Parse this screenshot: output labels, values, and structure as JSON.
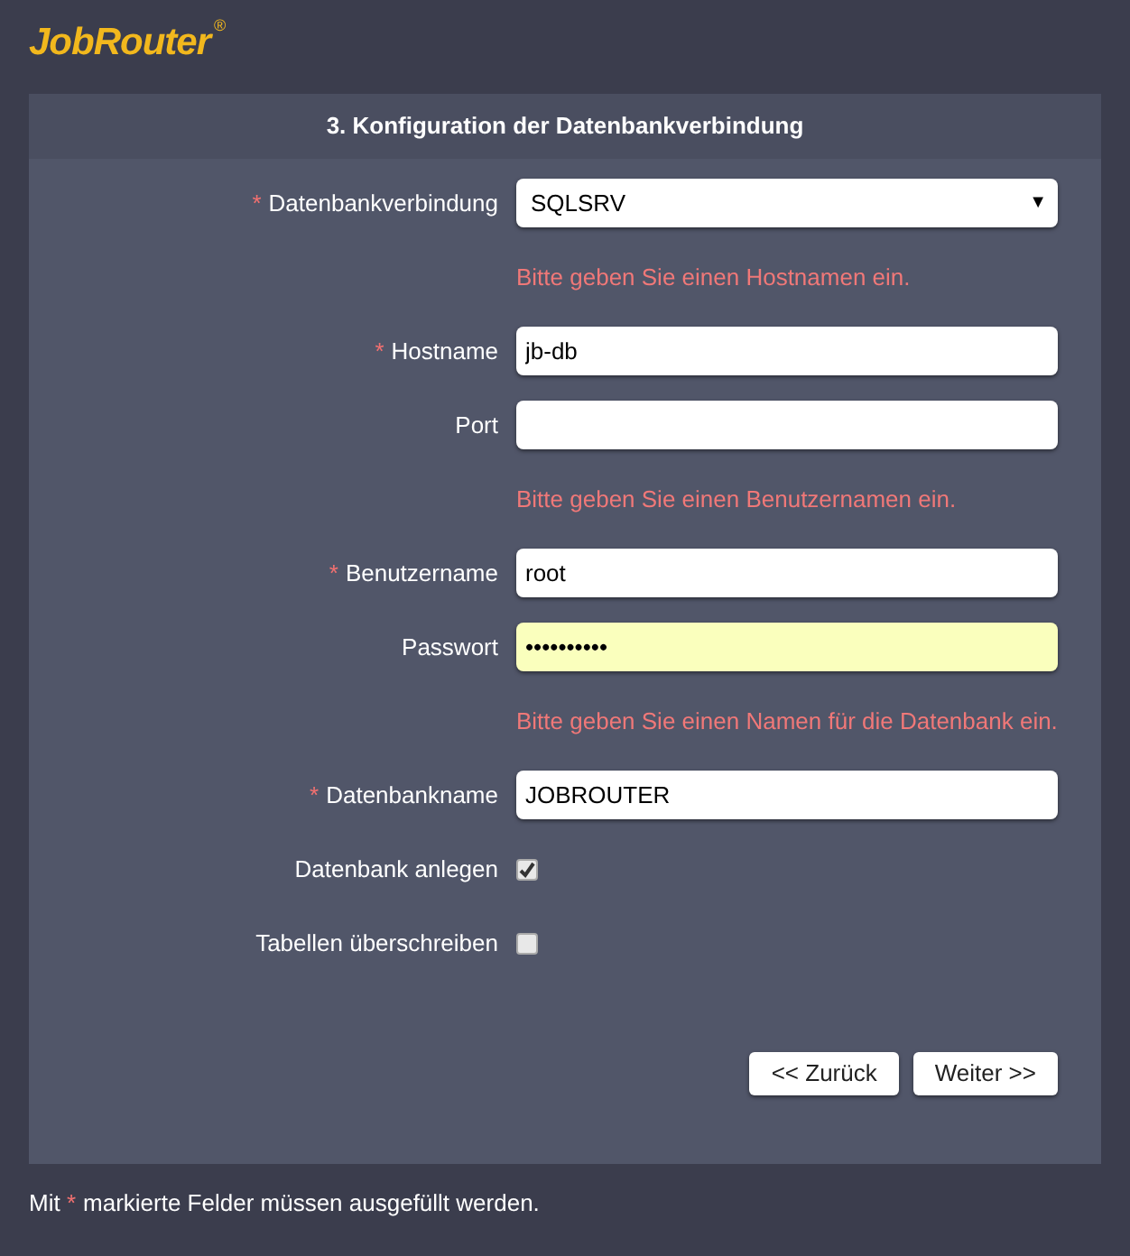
{
  "logo": {
    "name": "JobRouter",
    "mark": "®"
  },
  "panel": {
    "title": "3. Konfiguration der Datenbankverbindung"
  },
  "rows": [
    {
      "kind": "select",
      "label": "Datenbankverbindung",
      "required": true,
      "value": "SQLSRV",
      "arrow": "▼"
    },
    {
      "kind": "error",
      "text": "Bitte geben Sie einen Hostnamen ein."
    },
    {
      "kind": "text",
      "label": "Hostname",
      "required": true,
      "value": "jb-db",
      "autofilled": false
    },
    {
      "kind": "text",
      "label": "Port",
      "required": false,
      "value": "",
      "autofilled": false
    },
    {
      "kind": "error",
      "text": "Bitte geben Sie einen Benutzernamen ein."
    },
    {
      "kind": "text",
      "label": "Benutzername",
      "required": true,
      "value": "root",
      "autofilled": false
    },
    {
      "kind": "text",
      "label": "Passwort",
      "required": false,
      "value": "••••••••••",
      "autofilled": true
    },
    {
      "kind": "error",
      "text": "Bitte geben Sie einen Namen für die Datenbank ein."
    },
    {
      "kind": "text",
      "label": "Datenbankname",
      "required": true,
      "value": "JOBROUTER",
      "autofilled": false
    },
    {
      "kind": "checkbox",
      "label": "Datenbank anlegen",
      "checked": true
    },
    {
      "kind": "checkbox",
      "label": "Tabellen überschreiben",
      "checked": false
    }
  ],
  "buttons": [
    "<< Zurück",
    "Weiter >>"
  ],
  "required_marker": "*",
  "footnote": {
    "before": "Mit",
    "after": "markierte Felder müssen ausgefüllt werden."
  }
}
